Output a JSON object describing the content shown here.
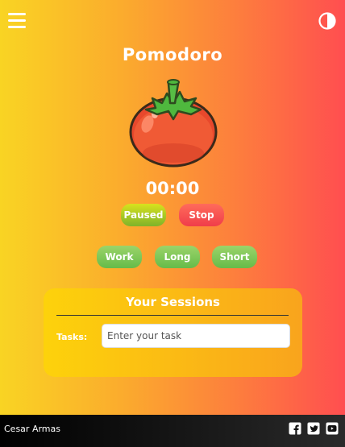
{
  "header": {
    "menu_icon": "hamburger-menu-icon",
    "theme_icon": "contrast-toggle-icon"
  },
  "app": {
    "title": "Pomodoro",
    "image_icon": "tomato-icon",
    "timer": "00:00"
  },
  "controls": {
    "paused_label": "Paused",
    "stop_label": "Stop"
  },
  "modes": {
    "work_label": "Work",
    "long_label": "Long",
    "short_label": "Short"
  },
  "sessions": {
    "title": "Your Sessions",
    "tasks_label": "Tasks:",
    "task_placeholder": "Enter your task",
    "task_value": ""
  },
  "footer": {
    "author": "Cesar Armas",
    "social": [
      "facebook-icon",
      "twitter-icon",
      "youtube-icon"
    ]
  },
  "colors": {
    "background_start": "#f9d423",
    "background_end": "#ff4e50",
    "paused_button": "#b7cf22",
    "stop_button": "#f45050",
    "mode_button": "#7cc95a",
    "sessions_panel": "#fbb913",
    "footer": "#111111"
  }
}
